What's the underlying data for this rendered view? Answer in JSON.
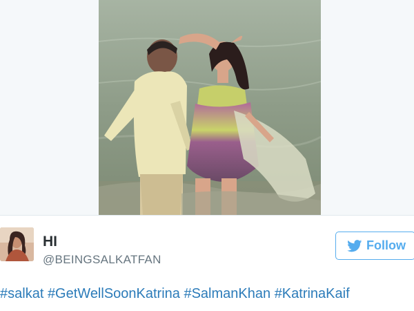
{
  "tweet": {
    "user": {
      "display_name": "HI",
      "handle": "@BEINGSALKATFAN"
    },
    "follow_button": {
      "label": "Follow",
      "icon": "twitter-bird-icon"
    },
    "hashtags": [
      "#salkat",
      "#GetWellSoonKatrina",
      "#SalmanKhan",
      "#KatrinaKaif"
    ]
  },
  "colors": {
    "accent": "#55acee",
    "link": "#2b7bb9",
    "name_text": "#292f33",
    "handle_text": "#66757f"
  }
}
